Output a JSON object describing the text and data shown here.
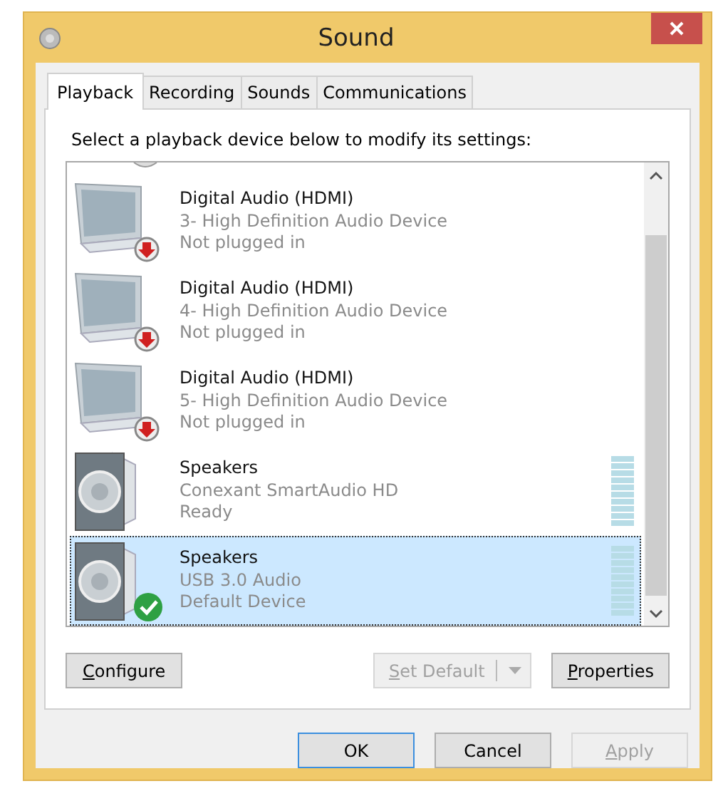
{
  "window": {
    "title": "Sound"
  },
  "tabs": [
    {
      "label": "Playback",
      "selected": true
    },
    {
      "label": "Recording",
      "selected": false
    },
    {
      "label": "Sounds",
      "selected": false
    },
    {
      "label": "Communications",
      "selected": false
    }
  ],
  "instruction": "Select a playback device below to modify its settings:",
  "devices": [
    {
      "kind": "monitor",
      "name": "Digital Audio (HDMI)",
      "description": "3- High Definition Audio Device",
      "status": "Not plugged in",
      "unplugged": true,
      "default": false,
      "selected": false
    },
    {
      "kind": "monitor",
      "name": "Digital Audio (HDMI)",
      "description": "4- High Definition Audio Device",
      "status": "Not plugged in",
      "unplugged": true,
      "default": false,
      "selected": false
    },
    {
      "kind": "monitor",
      "name": "Digital Audio (HDMI)",
      "description": "5- High Definition Audio Device",
      "status": "Not plugged in",
      "unplugged": true,
      "default": false,
      "selected": false
    },
    {
      "kind": "speaker",
      "name": "Speakers",
      "description": "Conexant SmartAudio HD",
      "status": "Ready",
      "unplugged": false,
      "default": false,
      "selected": false
    },
    {
      "kind": "speaker",
      "name": "Speakers",
      "description": "USB 3.0 Audio",
      "status": "Default Device",
      "unplugged": false,
      "default": true,
      "selected": true
    }
  ],
  "panel_buttons": [
    {
      "kind": "button",
      "label": "Configure",
      "disabled": false
    },
    {
      "kind": "split",
      "label": "Set Default",
      "disabled": true
    },
    {
      "kind": "button",
      "label": "Properties",
      "disabled": false
    }
  ],
  "dialog_buttons": [
    {
      "label": "OK",
      "default": true,
      "disabled": false,
      "access_key": false
    },
    {
      "label": "Cancel",
      "default": false,
      "disabled": false,
      "access_key": false
    },
    {
      "label": "Apply",
      "default": false,
      "disabled": true,
      "access_key": true
    }
  ]
}
